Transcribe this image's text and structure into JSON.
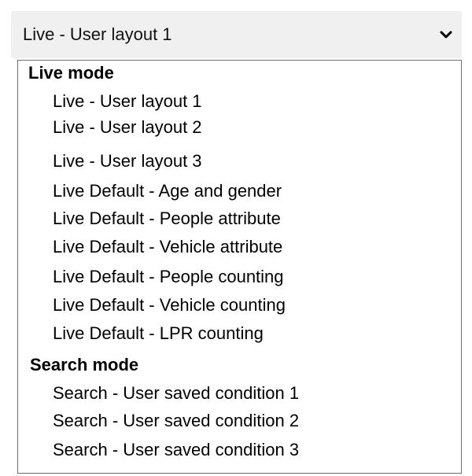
{
  "select": {
    "selected_value": "Live - User layout 1",
    "chevron_icon": "chevron-down-icon"
  },
  "groups": [
    {
      "label": "Live mode",
      "options": [
        "Live - User layout 1",
        "Live - User layout 2",
        "Live - User layout 3",
        "Live Default - Age and gender",
        "Live Default - People attribute",
        "Live Default - Vehicle attribute",
        "Live Default - People counting",
        "Live Default - Vehicle counting",
        "Live Default - LPR counting"
      ]
    },
    {
      "label": "Search mode",
      "options": [
        "Search - User saved condition 1",
        "Search - User saved condition 2",
        "Search - User saved condition 3"
      ]
    }
  ],
  "colors": {
    "header_background": "#f0f0f0",
    "listbox_border": "#6f6f6f",
    "text": "#000000"
  }
}
